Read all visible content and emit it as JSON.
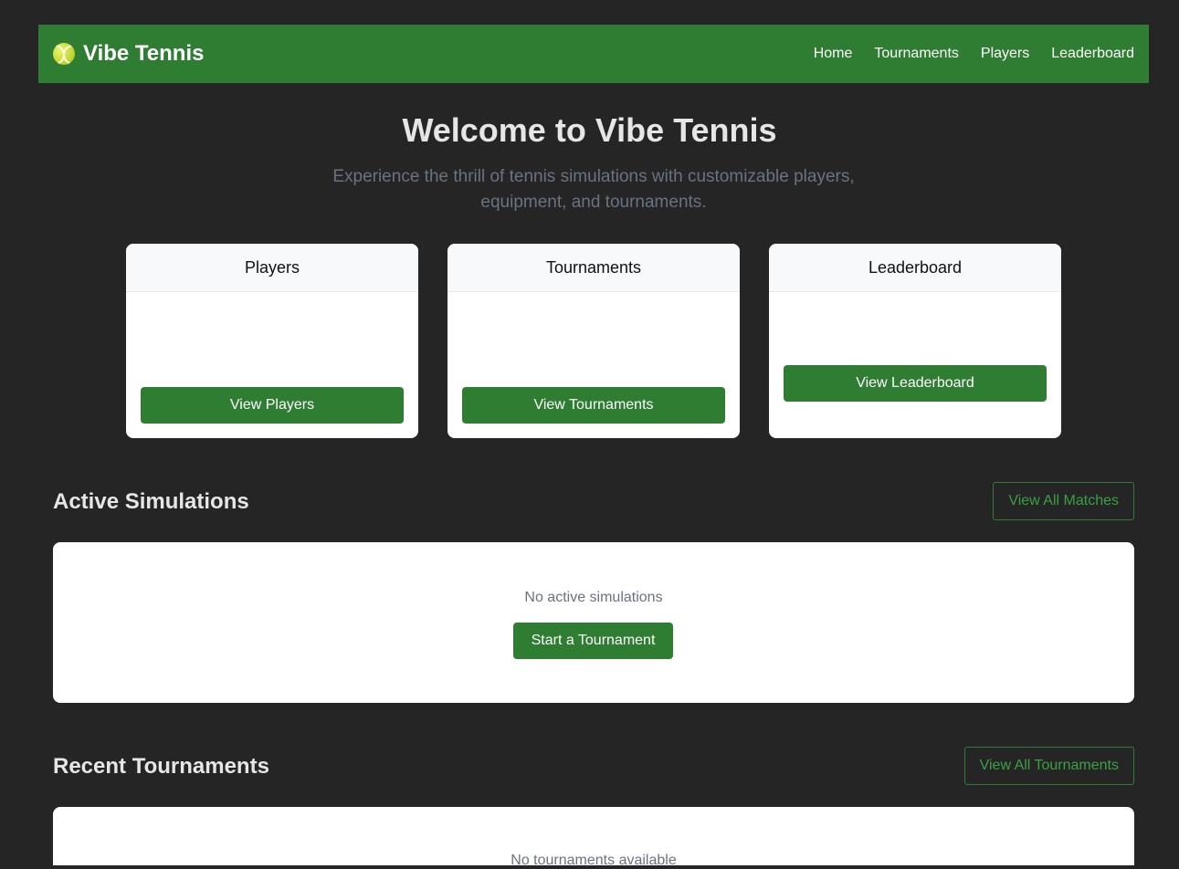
{
  "navbar": {
    "brand": "Vibe Tennis",
    "brand_icon": "tennis-ball-icon",
    "links": [
      "Home",
      "Tournaments",
      "Players",
      "Leaderboard"
    ],
    "color": "#2e7d32"
  },
  "hero": {
    "title": "Welcome to Vibe Tennis",
    "subtitle": "Experience the thrill of tennis simulations with customizable players, equipment, and tournaments."
  },
  "cards": [
    {
      "title": "Players",
      "button": "View Players"
    },
    {
      "title": "Tournaments",
      "button": "View Tournaments"
    },
    {
      "title": "Leaderboard",
      "button": "View Leaderboard"
    }
  ],
  "active_simulations": {
    "title": "Active Simulations",
    "view_all": "View All Matches",
    "empty_text": "No active simulations",
    "cta": "Start a Tournament"
  },
  "recent_tournaments": {
    "title": "Recent Tournaments",
    "view_all": "View All Tournaments",
    "empty_text": "No tournaments available"
  },
  "colors": {
    "background": "#252525",
    "accent": "#2e7d32",
    "card": "#ffffff"
  }
}
